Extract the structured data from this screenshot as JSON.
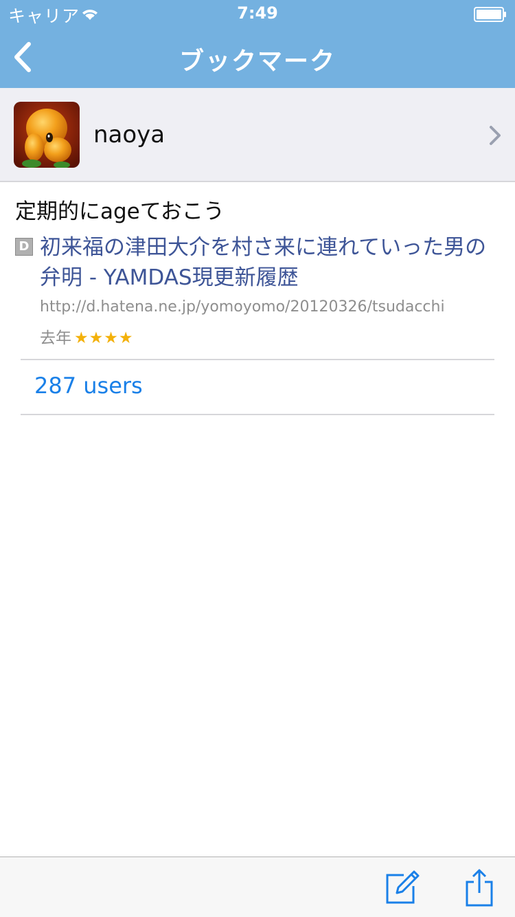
{
  "status_bar": {
    "carrier": "キャリア",
    "time": "7:49"
  },
  "nav": {
    "title": "ブックマーク",
    "back_icon": "chevron-left-icon"
  },
  "user": {
    "name": "naoya"
  },
  "bookmark": {
    "comment": "定期的にageておこう",
    "favicon_letter": "D",
    "title": "初来福の津田大介を村さ来に連れていった男の弁明 - YAMDAS現更新履歴",
    "url": "http://d.hatena.ne.jp/yomoyomo/20120326/tsudacchi",
    "date": "去年",
    "stars": "★★★★",
    "users_link": "287 users"
  },
  "toolbar": {
    "compose_icon": "compose-icon",
    "share_icon": "share-icon"
  },
  "colors": {
    "bar_blue": "#74b1e0",
    "link_blue": "#3e5597",
    "action_blue": "#1a80e8",
    "star": "#f3b10a"
  }
}
